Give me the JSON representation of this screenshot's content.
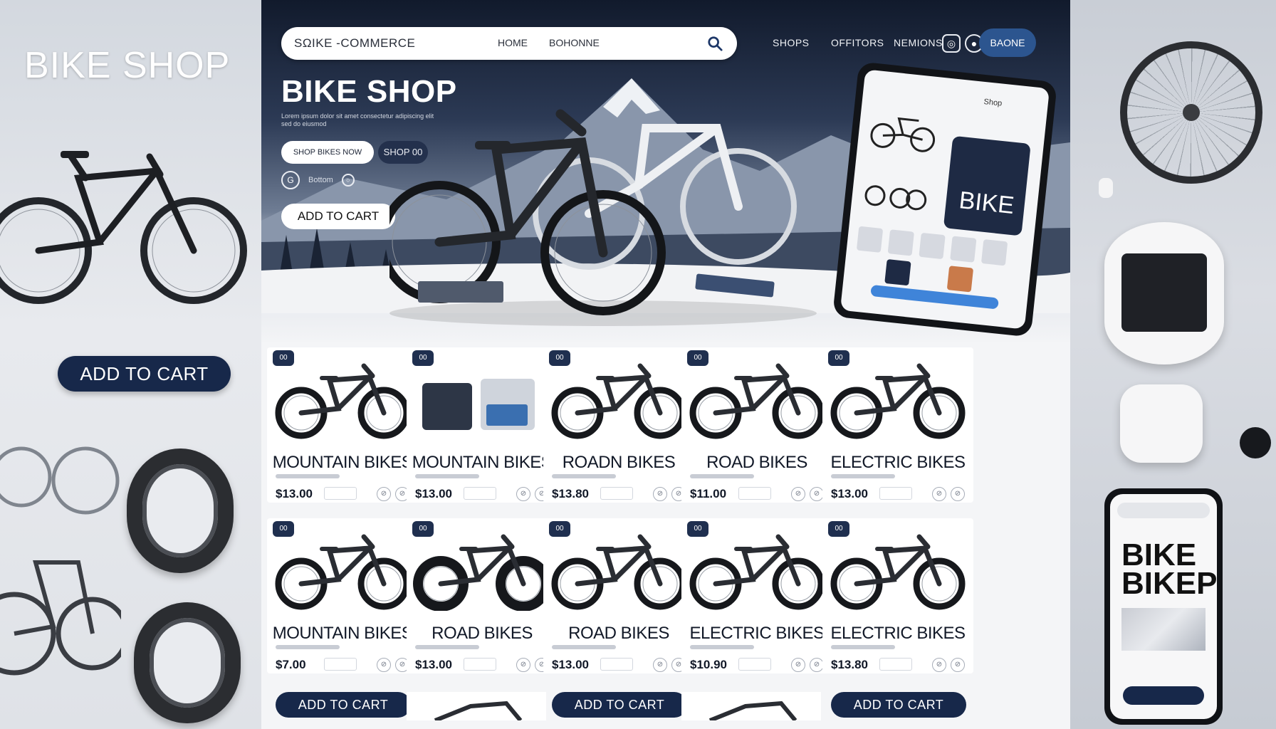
{
  "left_panel": {
    "title": "BIKE SHOP",
    "cart_button": "ADD TO CART"
  },
  "navbar": {
    "search_text": "SΩIKE -COMMERCE",
    "home_link": "HOME",
    "second_link": "BOHONNE",
    "links": [
      "SHOPS",
      "OFFITORS",
      "NEMIONS"
    ],
    "button_label": "BAONE",
    "icons": [
      "instagram-icon",
      "record-icon"
    ]
  },
  "hero": {
    "title": "BIKE SHOP",
    "subtitle": "Lorem ipsum dolor sit amet consectetur adipiscing elit sed do eiusmod",
    "pill_white": "SHOP BIKES NOW",
    "pill_dark": "SHOP 00",
    "small_row_text": "Bottom",
    "cart_button": "ADD TO CART",
    "tablet_text": "BIKE",
    "tablet_label": "Shop"
  },
  "products": [
    {
      "badge": "00",
      "title": "MOUNTAIN BIKES",
      "price": "$13.00",
      "kind": "bike"
    },
    {
      "badge": "00",
      "title": "MOUNTAIN BIKES",
      "price": "$13.00",
      "kind": "gear"
    },
    {
      "badge": "00",
      "title": "ROADN BIKES",
      "price": "$13.80",
      "kind": "bike"
    },
    {
      "badge": "00",
      "title": "ROAD  BIKES",
      "price": "$11.00",
      "kind": "bike"
    },
    {
      "badge": "00",
      "title": "ELECTRIC BIKES",
      "price": "$13.00",
      "kind": "bike"
    },
    {
      "badge": "00",
      "title": "MOUNTAIN BIKES",
      "price": "$7.00",
      "kind": "bike"
    },
    {
      "badge": "00",
      "title": "ROAD   BIKES",
      "price": "$13.00",
      "kind": "fatbike"
    },
    {
      "badge": "00",
      "title": "ROAD   BIKES",
      "price": "$13.00",
      "kind": "bike"
    },
    {
      "badge": "00",
      "title": "ELECTRIC BIKES",
      "price": "$10.90",
      "kind": "bike"
    },
    {
      "badge": "00",
      "title": "ELECTRIC BIKES",
      "price": "$13.80",
      "kind": "bike"
    }
  ],
  "bottom_cart_label": "ADD TO CART",
  "right_panel": {
    "phone_brand_line1": "BIKE",
    "phone_brand_line2": "BIKEP"
  },
  "colors": {
    "navy": "#17284a",
    "accent_blue": "#2c558f",
    "badge": "#1f2f4f"
  }
}
